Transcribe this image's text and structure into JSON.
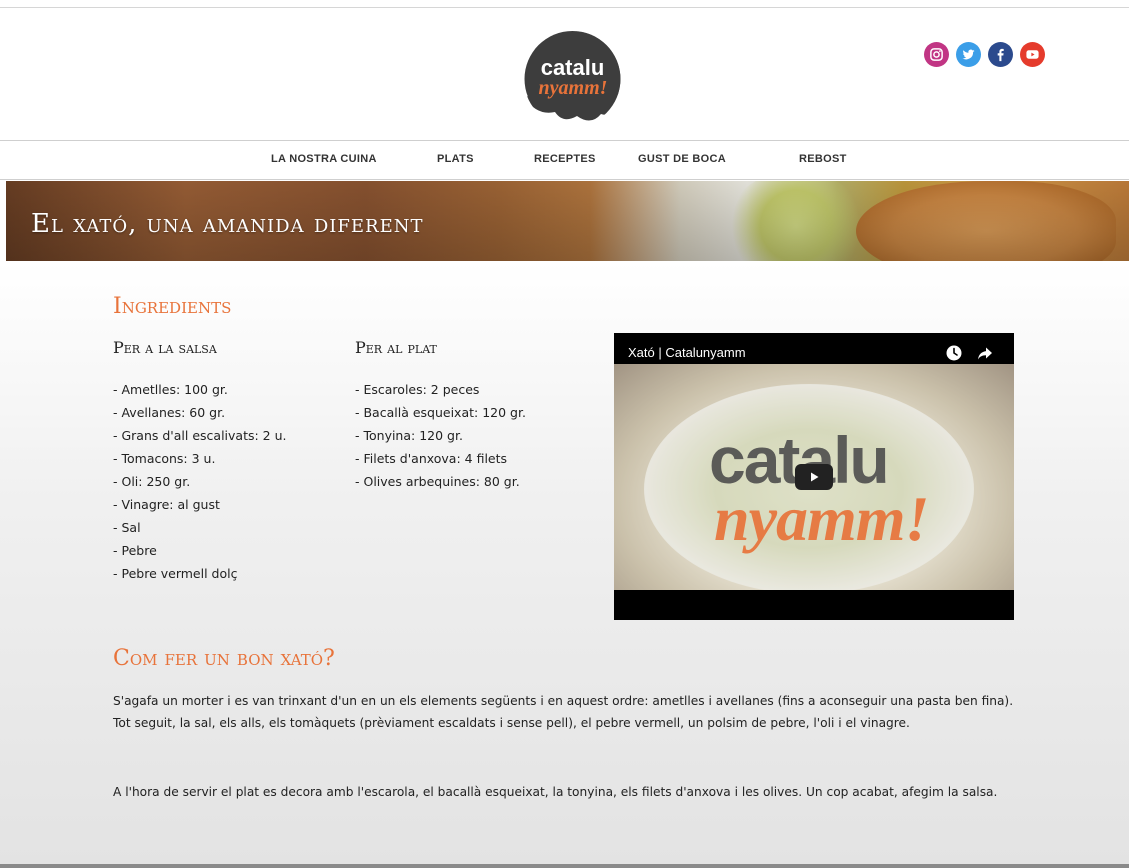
{
  "header": {
    "logo": {
      "line1": "catalu",
      "line2": "nyamm!"
    },
    "social": [
      "instagram-icon",
      "twitter-icon",
      "facebook-icon",
      "youtube-icon"
    ],
    "colors": {
      "instagram": "#c13584",
      "twitter": "#3b9ee8",
      "facebook": "#2b4a8d",
      "youtube": "#e53b2c",
      "logo_circle": "#3d3d3d",
      "logo_accent": "#e8733a"
    }
  },
  "nav": {
    "items": [
      "LA NOSTRA CUINA",
      "PLATS",
      "RECEPTES",
      "GUST DE BOCA",
      "REBOST"
    ]
  },
  "banner": {
    "title": "El xató, una amanida diferent"
  },
  "ingredients": {
    "heading": "Ingredients",
    "salsa": {
      "title": "Per a la salsa",
      "items": [
        "- Ametlles: 100 gr.",
        "- Avellanes: 60 gr.",
        "- Grans d'all escalivats: 2 u.",
        "- Tomacons: 3 u.",
        "- Oli: 250 gr.",
        "- Vinagre: al gust",
        "- Sal",
        "- Pebre",
        "- Pebre vermell dolç"
      ]
    },
    "plat": {
      "title": "Per al plat",
      "items": [
        "- Escaroles: 2 peces",
        "- Bacallà esqueixat: 120 gr.",
        "- Tonyina: 120 gr.",
        "- Filets d'anxova: 4 filets",
        "- Olives arbequines: 80 gr."
      ]
    }
  },
  "video": {
    "title": "Xató | Catalunyamm",
    "watermark_line1": "catalu",
    "watermark_line2": "nyamm!"
  },
  "how": {
    "heading": "Com fer un bon xató?",
    "paragraphs": [
      "S'agafa un morter i es van trinxant d'un en un els elements següents i en aquest ordre: ametlles i avellanes (fins a aconseguir una pasta ben fina). Tot seguit, la sal, els alls, els tomàquets (prèviament escaldats i sense pell), el pebre vermell, un polsim de pebre, l'oli i el vinagre.",
      "A l'hora de servir el plat es decora amb l'escarola, el bacallà esqueixat, la tonyina, els filets d'anxova i les olives. Un cop acabat, afegim la salsa."
    ]
  },
  "accent_color": "#e8733a"
}
